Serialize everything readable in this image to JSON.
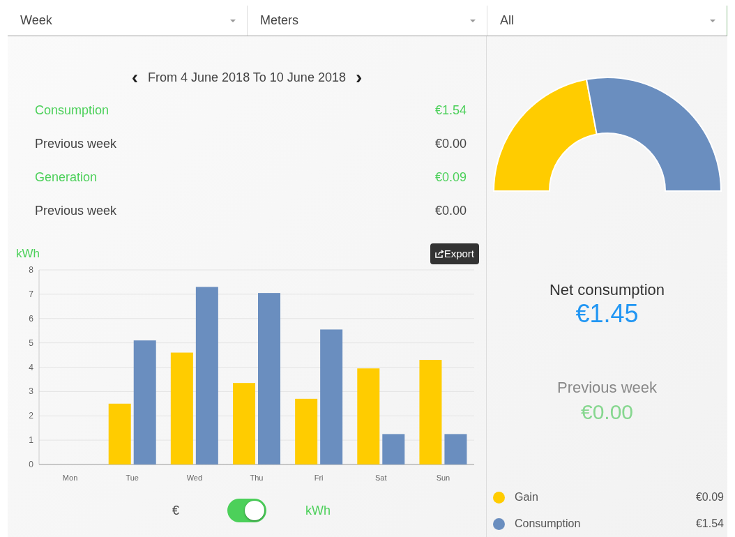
{
  "filters": [
    {
      "value": "Week"
    },
    {
      "value": "Meters"
    },
    {
      "value": "All"
    }
  ],
  "period": {
    "prev": "‹",
    "label": "From 4 June 2018 To 10 June 2018",
    "next": "›"
  },
  "summary": [
    {
      "kind": "total",
      "label": "Consumption",
      "value": "€1.54"
    },
    {
      "kind": "previous",
      "label": "Previous week",
      "value": "€0.00"
    },
    {
      "kind": "total",
      "label": "Generation",
      "value": "€0.09"
    },
    {
      "kind": "previous",
      "label": "Previous week",
      "value": "€0.00"
    }
  ],
  "chart": {
    "export_button": "Export",
    "chart_data": {
      "type": "bar",
      "ylabel": "kWh",
      "grid": true,
      "categories": [
        "Mon",
        "Tue",
        "Wed",
        "Thu",
        "Fri",
        "Sat",
        "Sun"
      ],
      "series": [
        {
          "color": "#ffcc00",
          "values": [
            0,
            2.5,
            4.6,
            3.35,
            2.7,
            3.95,
            4.3
          ]
        },
        {
          "color": "#6a8ebf",
          "values": [
            0,
            5.1,
            7.3,
            7.05,
            5.55,
            1.25,
            1.25
          ]
        }
      ],
      "ylim": [
        0,
        8
      ],
      "yticks": [
        0,
        1,
        2,
        3,
        4,
        5,
        6,
        7,
        8
      ]
    }
  },
  "unit_toggle": {
    "left_label": "€",
    "right_label": "kWh",
    "on": true
  },
  "net": {
    "label": "Net consumption",
    "value": "€1.45"
  },
  "previous": {
    "label": "Previous week",
    "value": "€0.00"
  },
  "legend": [
    {
      "label": "Gain",
      "value": "€0.09",
      "color": "#ffcc00"
    },
    {
      "label": "Consumption",
      "value": "€1.54",
      "color": "#6a8ebf"
    }
  ]
}
